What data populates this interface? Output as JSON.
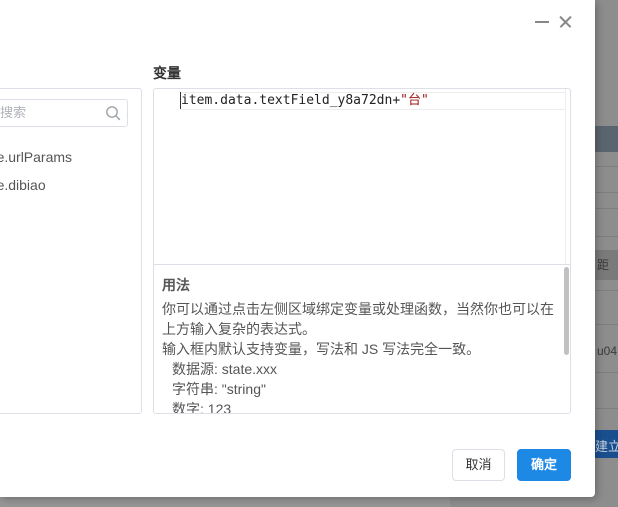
{
  "background": {
    "fragments": [
      "距",
      "u04",
      "建立"
    ]
  },
  "modal": {
    "variables_title": "变量",
    "search": {
      "placeholder": "搜索"
    },
    "variables": [
      {
        "label": "tate.urlParams"
      },
      {
        "label": "tate.dibiao"
      }
    ],
    "editor": {
      "code_plain": "item.data.textField_y8a72dn+",
      "code_string": "\"台\""
    },
    "usage": {
      "title": "用法",
      "lines": [
        "你可以通过点击左侧区域绑定变量或处理函数，当然你也可以在",
        "上方输入复杂的表达式。",
        "输入框内默认支持变量，写法和 JS 写法完全一致。"
      ],
      "examples": [
        "数据源: state.xxx",
        "字符串: \"string\"",
        "数字: 123"
      ]
    },
    "footer": {
      "cancel_label": "取消",
      "ok_label": "确定"
    }
  },
  "colors": {
    "primary": "#1e88e5",
    "border": "#dcdfe6"
  }
}
